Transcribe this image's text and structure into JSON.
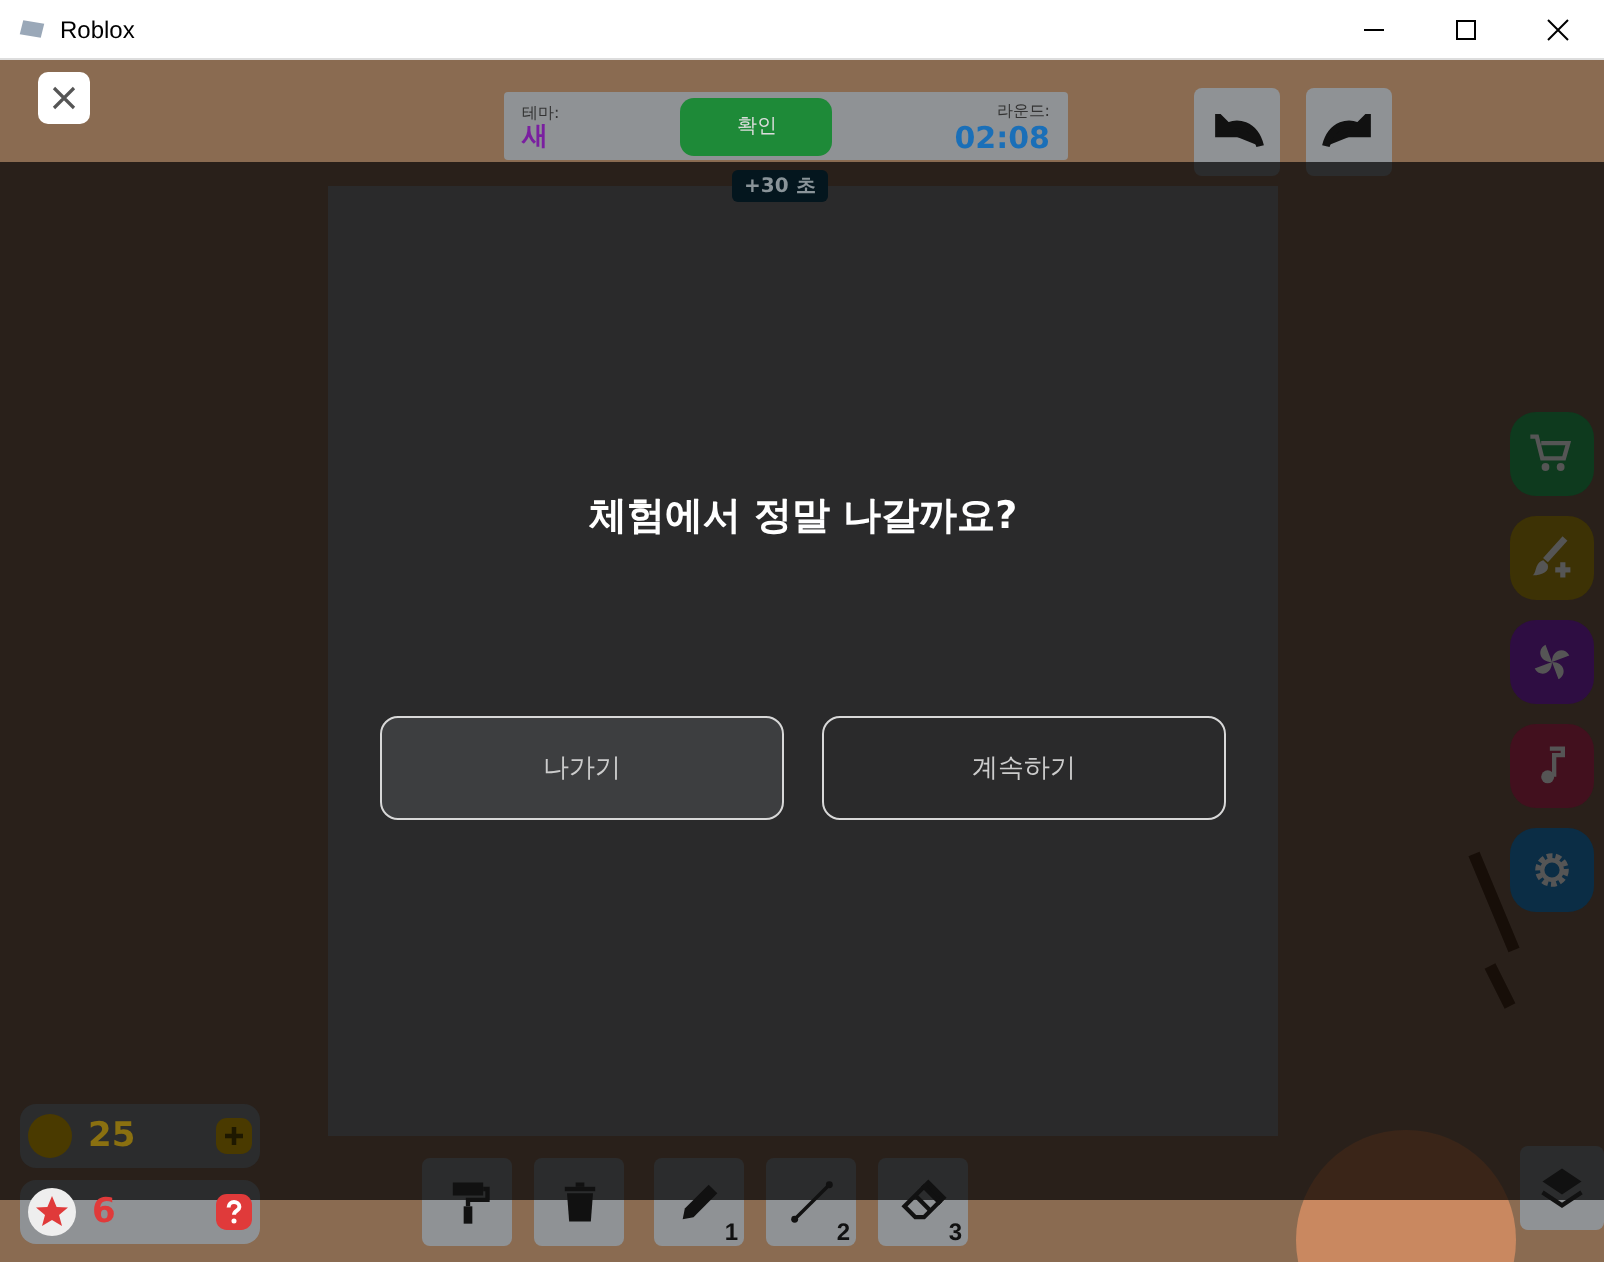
{
  "window": {
    "title": "Roblox"
  },
  "top_bar": {
    "theme_label": "테마:",
    "theme_value": "새",
    "confirm_button": "확인",
    "round_label": "라운드:",
    "timer": "02:08",
    "bonus_badge": "+30 초"
  },
  "dialog": {
    "question": "체험에서 정말 나갈까요?",
    "buttons": [
      {
        "label": "나가기",
        "selected": true
      },
      {
        "label": "계속하기",
        "selected": false
      }
    ]
  },
  "side_buttons": [
    {
      "kind": "cart",
      "color": "#0e3a1e"
    },
    {
      "kind": "brush",
      "color": "#3d3205"
    },
    {
      "kind": "pinwheel",
      "color": "#2e0d42"
    },
    {
      "kind": "music",
      "color": "#42101e"
    },
    {
      "kind": "gear",
      "color": "#0b2d45"
    }
  ],
  "tools": [
    {
      "kind": "roller"
    },
    {
      "kind": "trash"
    },
    {
      "kind": "pencil",
      "key": "1"
    },
    {
      "kind": "line",
      "key": "2"
    },
    {
      "kind": "eraser",
      "key": "3"
    }
  ],
  "currency": {
    "coins": "25",
    "stars": "6"
  }
}
